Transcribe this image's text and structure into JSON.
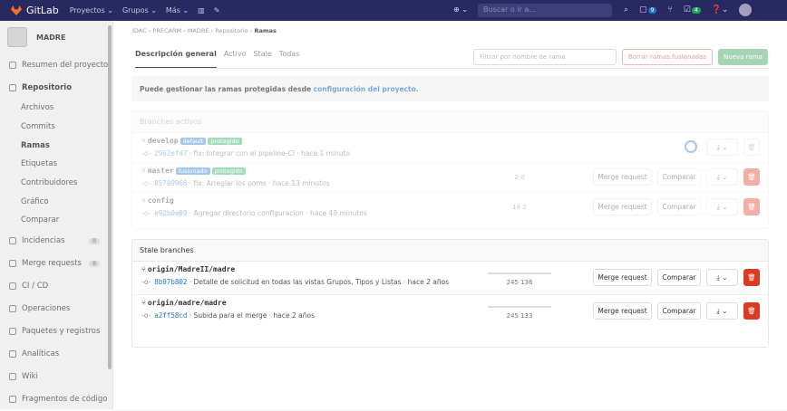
{
  "topbar": {
    "brand": "GitLab",
    "nav": [
      "Proyectos ⌄",
      "Grupos ⌄",
      "Más ⌄"
    ],
    "search_placeholder": "Buscar o ir a...",
    "plus": "⊕ ⌄",
    "issues_count": "9",
    "mr_count": "4",
    "help": "❓⌄"
  },
  "sidebar": {
    "project": "MADRE",
    "items": [
      {
        "label": "Resumen del proyecto"
      },
      {
        "label": "Repositorio"
      },
      {
        "label": "Archivos"
      },
      {
        "label": "Commits"
      },
      {
        "label": "Ramas"
      },
      {
        "label": "Etiquetas"
      },
      {
        "label": "Contribuidores"
      },
      {
        "label": "Gráfico"
      },
      {
        "label": "Comparar"
      },
      {
        "label": "Incidencias",
        "count": "0"
      },
      {
        "label": "Merge requests",
        "count": "0"
      },
      {
        "label": "CI / CD"
      },
      {
        "label": "Operaciones"
      },
      {
        "label": "Paquetes y registros"
      },
      {
        "label": "Analíticas"
      },
      {
        "label": "Wiki"
      },
      {
        "label": "Fragmentos de código"
      }
    ]
  },
  "breadcrumb": {
    "a": "IDAC",
    "b": "PRECARM",
    "c": "MADRE",
    "d": "Repositorio",
    "e": "Ramas"
  },
  "tabs": [
    "Descripción general",
    "Activo",
    "Stale",
    "Todas"
  ],
  "filter_placeholder": "Filtrar por nombre de rama",
  "delete_merged": "Borrar ramas fusionadas",
  "new_branch": "Nueva rama",
  "alert": {
    "text": "Puede gestionar las ramas protegidas desde ",
    "link": "configuración del proyecto."
  },
  "active": {
    "title": "Branches activos",
    "branches": [
      {
        "name": "develop",
        "labels": [
          "default",
          "protegido"
        ],
        "sha": "2962efd7",
        "msg": " · fix: Integrar con el pipeline-CI · hace 1 minuto",
        "div": ""
      },
      {
        "name": "master",
        "labels": [
          "fusionado",
          "protegido"
        ],
        "sha": "85709966",
        "msg": " · fix: Arreglar los poms · hace 13 minutos",
        "div": "2 0"
      },
      {
        "name": "config",
        "labels": [],
        "sha": "e92b0e09",
        "msg": " · Agregar directorio configuracion · hace 49 minutos",
        "div": "14 2"
      }
    ]
  },
  "stale": {
    "title": "Stale branches",
    "branches": [
      {
        "name": "origin/MadreII/madre",
        "sha": "8b97b802",
        "msg": " · Detalle de solicitud en todas las vistas Grupos, Tipos y Listas · hace 2 años",
        "div": "245 136"
      },
      {
        "name": "origin/madre/madre",
        "sha": "a2ff58cd",
        "msg": " · Subida para el merge · hace 2 años",
        "div": "245 133"
      }
    ]
  },
  "buttons": {
    "merge": "Merge request",
    "compare": "Comparar",
    "download": "⤓ ⌄",
    "delete": "🗑"
  }
}
